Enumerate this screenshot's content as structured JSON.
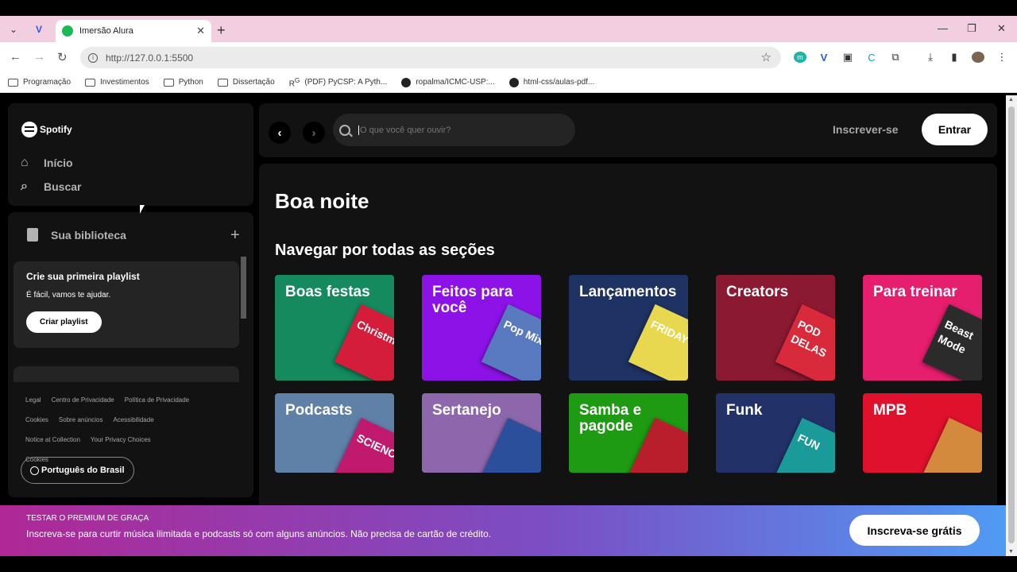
{
  "browser": {
    "tab_title": "Imersão Alura",
    "url": "http://127.0.0.1:5500",
    "bookmarks": [
      {
        "label": "Programação",
        "icon": "folder-icon"
      },
      {
        "label": "Investimentos",
        "icon": "folder-icon"
      },
      {
        "label": "Python",
        "icon": "folder-icon"
      },
      {
        "label": "Dissertação",
        "icon": "folder-icon"
      },
      {
        "label": "(PDF) PyCSP: A Pyth...",
        "icon": "researchgate-icon"
      },
      {
        "label": "ropalma/ICMC-USP:...",
        "icon": "github-icon"
      },
      {
        "label": "html-css/aulas-pdf...",
        "icon": "github-icon"
      }
    ]
  },
  "sidebar": {
    "logo_text": "Spotify",
    "nav": [
      {
        "label": "Início",
        "icon": "home-icon"
      },
      {
        "label": "Buscar",
        "icon": "search-icon"
      }
    ],
    "library": {
      "title": "Sua biblioteca",
      "card_title": "Crie sua primeira playlist",
      "card_text": "É fácil, vamos te ajudar.",
      "card_button": "Criar playlist"
    },
    "footer_links": [
      "Legal",
      "Centro de Privacidade",
      "Política de Privacidade",
      "Cookies",
      "Sobre anúncios",
      "Acessibilidade",
      "Notice at Collection",
      "Your Privacy Choices",
      "Cookies"
    ],
    "language_button": "Português do Brasil"
  },
  "header": {
    "search_placeholder": "O que você quer ouvir?",
    "signup": "Inscrever-se",
    "login": "Entrar"
  },
  "main": {
    "greeting": "Boa noite",
    "section_title": "Navegar por todas as seções",
    "cards": [
      {
        "title": "Boas festas",
        "color": "#148a5e",
        "art_color": "#d31d3a",
        "art_text": "Christm Hi"
      },
      {
        "title": "Feitos para você",
        "color": "#8d12e8",
        "art_color": "#5a7ac0",
        "art_text": "Pop Mix"
      },
      {
        "title": "Lançamentos",
        "color": "#1e3264",
        "art_color": "#e8d84f",
        "art_text": "FRIDAY"
      },
      {
        "title": "Creators",
        "color": "#8c1932",
        "art_color": "#d82a3a",
        "art_text": "POD DELAS"
      },
      {
        "title": "Para treinar",
        "color": "#e61e6e",
        "art_color": "#2b2b2b",
        "art_text": "Beast Mode"
      },
      {
        "title": "Podcasts",
        "color": "#5f81a8",
        "art_color": "#c01a6e",
        "art_text": "SCIENC"
      },
      {
        "title": "Sertanejo",
        "color": "#8d67ab",
        "art_color": "#2c4f9c",
        "art_text": ""
      },
      {
        "title": "Samba e pagode",
        "color": "#1e9a13",
        "art_color": "#b91e2c",
        "art_text": ""
      },
      {
        "title": "Funk",
        "color": "#223269",
        "art_color": "#1a9a98",
        "art_text": "FUN"
      },
      {
        "title": "MPB",
        "color": "#e0112c",
        "art_color": "#d48a3c",
        "art_text": ""
      }
    ]
  },
  "banner": {
    "line1": "TESTAR O PREMIUM DE GRAÇA",
    "line2": "Inscreva-se para curtir música ilimitada e podcasts só com alguns anúncios. Não precisa de cartão de crédito.",
    "button": "Inscreva-se grátis"
  }
}
